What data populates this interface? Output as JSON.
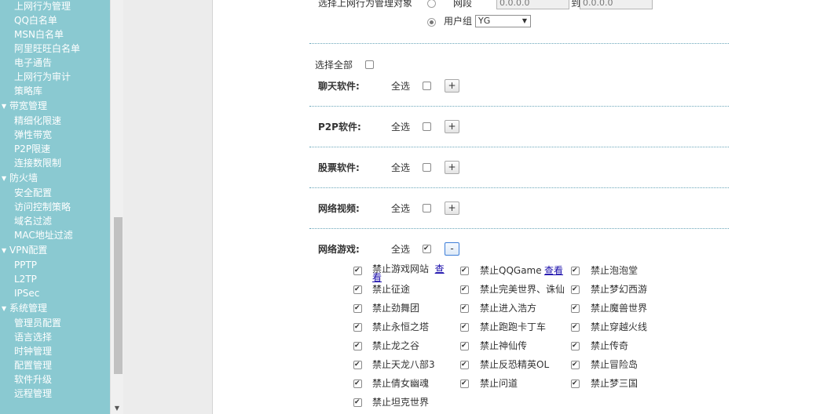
{
  "sidebar": {
    "items": [
      {
        "type": "item",
        "label": "上网行为管理"
      },
      {
        "type": "item",
        "label": "QQ白名单"
      },
      {
        "type": "item",
        "label": "MSN白名单"
      },
      {
        "type": "item",
        "label": "阿里旺旺白名单"
      },
      {
        "type": "item",
        "label": "电子通告"
      },
      {
        "type": "item",
        "label": "上网行为审计"
      },
      {
        "type": "item",
        "label": "策略库"
      },
      {
        "type": "group",
        "label": "带宽管理"
      },
      {
        "type": "item",
        "label": "精细化限速"
      },
      {
        "type": "item",
        "label": "弹性带宽"
      },
      {
        "type": "item",
        "label": "P2P限速"
      },
      {
        "type": "item",
        "label": "连接数限制"
      },
      {
        "type": "group",
        "label": "防火墙"
      },
      {
        "type": "item",
        "label": "安全配置"
      },
      {
        "type": "item",
        "label": "访问控制策略"
      },
      {
        "type": "item",
        "label": "域名过滤"
      },
      {
        "type": "item",
        "label": "MAC地址过滤"
      },
      {
        "type": "group",
        "label": "VPN配置"
      },
      {
        "type": "item",
        "label": "PPTP"
      },
      {
        "type": "item",
        "label": "L2TP"
      },
      {
        "type": "item",
        "label": "IPSec"
      },
      {
        "type": "group",
        "label": "系统管理"
      },
      {
        "type": "item",
        "label": "管理员配置"
      },
      {
        "type": "item",
        "label": "语言选择"
      },
      {
        "type": "item",
        "label": "时钟管理"
      },
      {
        "type": "item",
        "label": "配置管理"
      },
      {
        "type": "item",
        "label": "软件升级"
      },
      {
        "type": "item",
        "label": "远程管理"
      }
    ],
    "group_icon": "triangle-down-icon"
  },
  "target": {
    "label": "选择上网行为管理对象",
    "segment_label": "网段",
    "segment_from": "0.0.0.0",
    "to_label": "到",
    "segment_to": "0.0.0.0",
    "group_label": "用户组",
    "group_value": "YG",
    "selected": "group"
  },
  "select_all": {
    "label": "选择全部",
    "checked": false
  },
  "categories": [
    {
      "label": "聊天软件:",
      "all_label": "全选",
      "checked": false,
      "toggle": "+"
    },
    {
      "label": "P2P软件:",
      "all_label": "全选",
      "checked": false,
      "toggle": "+"
    },
    {
      "label": "股票软件:",
      "all_label": "全选",
      "checked": false,
      "toggle": "+"
    },
    {
      "label": "网络视频:",
      "all_label": "全选",
      "checked": false,
      "toggle": "+"
    },
    {
      "label": "网络游戏:",
      "all_label": "全选",
      "checked": true,
      "toggle": "-"
    }
  ],
  "games": {
    "rows": [
      [
        {
          "label": "禁止游戏网站",
          "link": "查看",
          "checked": true
        },
        {
          "label": "禁止QQGame",
          "link": "查看",
          "checked": true
        },
        {
          "label": "禁止泡泡堂",
          "checked": true
        }
      ],
      [
        {
          "label": "禁止征途",
          "checked": true
        },
        {
          "label": "禁止完美世界、诛仙",
          "checked": true
        },
        {
          "label": "禁止梦幻西游",
          "checked": true
        }
      ],
      [
        {
          "label": "禁止劲舞团",
          "checked": true
        },
        {
          "label": "禁止进入浩方",
          "checked": true
        },
        {
          "label": "禁止魔兽世界",
          "checked": true
        }
      ],
      [
        {
          "label": "禁止永恒之塔",
          "checked": true
        },
        {
          "label": "禁止跑跑卡丁车",
          "checked": true
        },
        {
          "label": "禁止穿越火线",
          "checked": true
        }
      ],
      [
        {
          "label": "禁止龙之谷",
          "checked": true
        },
        {
          "label": "禁止神仙传",
          "checked": true
        },
        {
          "label": "禁止传奇",
          "checked": true
        }
      ],
      [
        {
          "label": "禁止天龙八部3",
          "checked": true
        },
        {
          "label": "禁止反恐精英OL",
          "checked": true
        },
        {
          "label": "禁止冒险岛",
          "checked": true
        }
      ],
      [
        {
          "label": "禁止倩女幽魂",
          "checked": true
        },
        {
          "label": "禁止问道",
          "checked": true
        },
        {
          "label": "禁止梦三国",
          "checked": true
        }
      ],
      [
        {
          "label": "禁止坦克世界",
          "checked": true
        }
      ]
    ]
  }
}
